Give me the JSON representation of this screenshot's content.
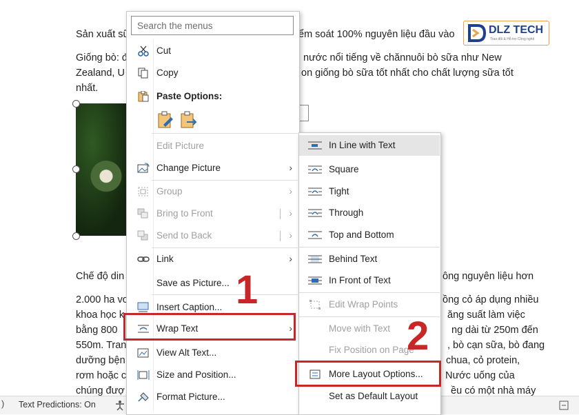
{
  "document": {
    "lines": [
      "Sản xuất sữ",
      "ểm soát 100% nguyên liệu đầu vào",
      "Giống bò: đ",
      "nước nổi tiếng về chănnuôi bò sữa như New",
      "Zealand, U",
      "on giống bò sữa tốt nhất cho chất lượng sữa tốt",
      "nhất.",
      "Chế độ din",
      "ông nguyên liệu hơn",
      "2.000 ha vơ",
      "ồng cỏ áp dụng nhiều",
      "khoa học k",
      "ăng suất làm việc",
      "bằng 800",
      "ng dài từ 250m đến",
      "550m. Tran",
      ", bò cạn sữa, bò đang",
      "dưỡng bện",
      "chua, cỏ protein,",
      "rơm hoặc c",
      "Nước uống của",
      "chúng đượ",
      "ều có một nhà máy"
    ]
  },
  "logo": {
    "brand_text": "DLZ TECH",
    "tagline": "Trao đổi & Hỗ trợ Công nghệ"
  },
  "statusbar": {
    "text_predictions": "Text Predictions: On"
  },
  "context_menu": {
    "search_placeholder": "Search the menus",
    "items": {
      "cut": "Cut",
      "copy": "Copy",
      "paste_options": "Paste Options:",
      "edit_picture": "Edit Picture",
      "change_picture": "Change Picture",
      "group": "Group",
      "bring_to_front": "Bring to Front",
      "send_to_back": "Send to Back",
      "link": "Link",
      "save_as_picture": "Save as Picture...",
      "insert_caption": "Insert Caption...",
      "wrap_text": "Wrap Text",
      "view_alt_text": "View Alt Text...",
      "size_and_position": "Size and Position...",
      "format_picture": "Format Picture..."
    }
  },
  "wrap_submenu": {
    "items": {
      "in_line": "In Line with Text",
      "square": "Square",
      "tight": "Tight",
      "through": "Through",
      "top_bottom": "Top and Bottom",
      "behind": "Behind Text",
      "in_front": "In Front of Text",
      "edit_wrap": "Edit Wrap Points",
      "move_with": "Move with Text",
      "fix_position": "Fix Position on Page",
      "more_layout": "More Layout Options...",
      "set_default": "Set as Default Layout"
    }
  },
  "callouts": {
    "step1": "1",
    "step2": "2"
  },
  "colors": {
    "callout_red": "#c62828",
    "logo_blue": "#1f3f8f",
    "logo_orange": "#e8a24a",
    "hover_gray": "#e5e5e5"
  }
}
